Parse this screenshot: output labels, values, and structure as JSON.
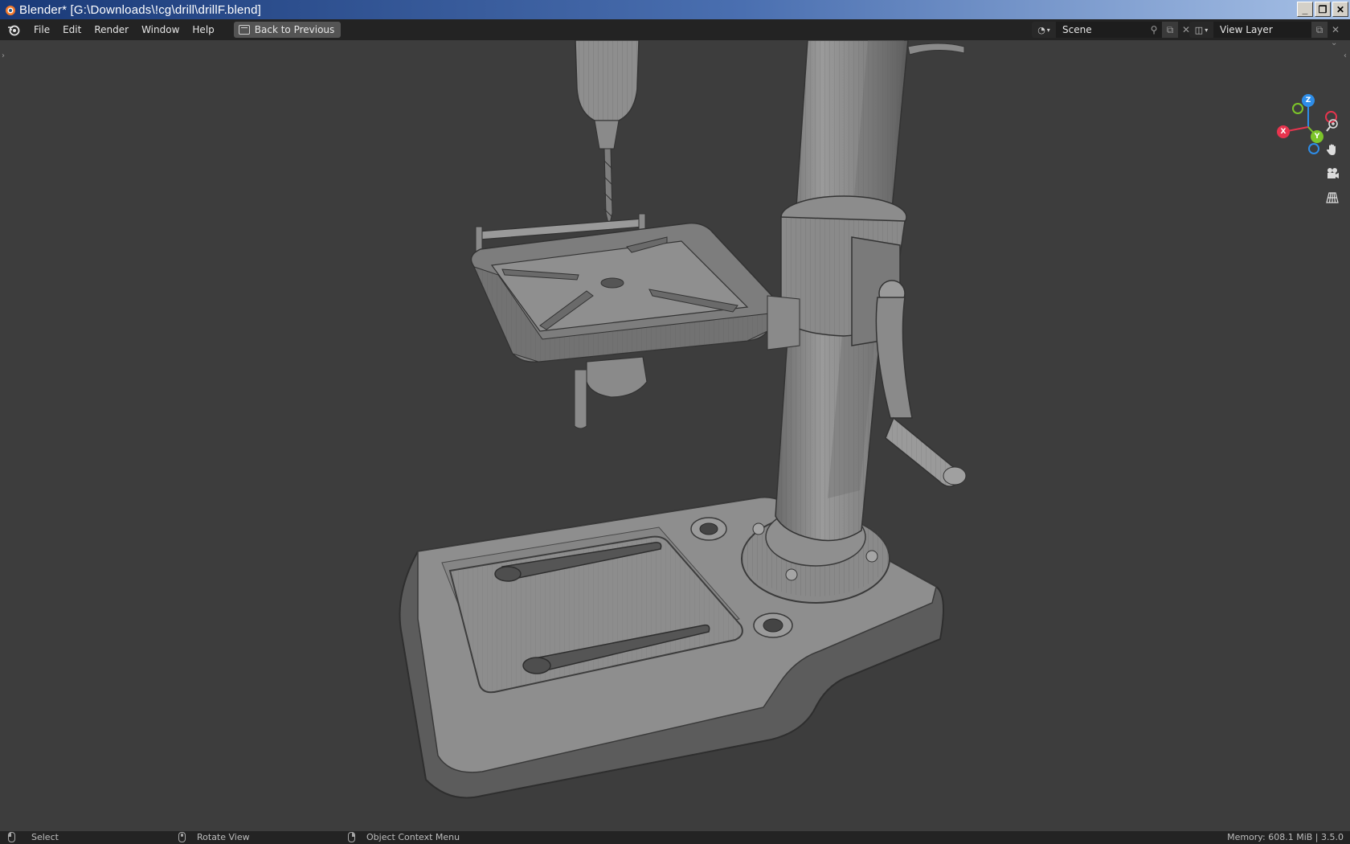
{
  "window": {
    "title": "Blender* [G:\\Downloads\\!cg\\drill\\drillF.blend]",
    "minimize_label": "_",
    "restore_label": "❐",
    "close_label": "✕"
  },
  "menubar": {
    "items": [
      "File",
      "Edit",
      "Render",
      "Window",
      "Help"
    ],
    "back_button_label": "Back to Previous",
    "scene": "Scene",
    "view_layer": "View Layer"
  },
  "gizmo": {
    "x_label": "X",
    "y_label": "Y",
    "z_label": "Z",
    "colors": {
      "x": "#e8344e",
      "y": "#7cc42a",
      "z": "#2e8de8"
    }
  },
  "viewport": {
    "nav_icons": [
      "zoom-icon",
      "pan-hand-icon",
      "camera-icon",
      "perspective-grid-icon"
    ]
  },
  "statusbar": {
    "select_label": "Select",
    "rotate_label": "Rotate View",
    "context_label": "Object Context Menu",
    "memory": "Memory: 608.1 MiB | 3.5.0"
  }
}
